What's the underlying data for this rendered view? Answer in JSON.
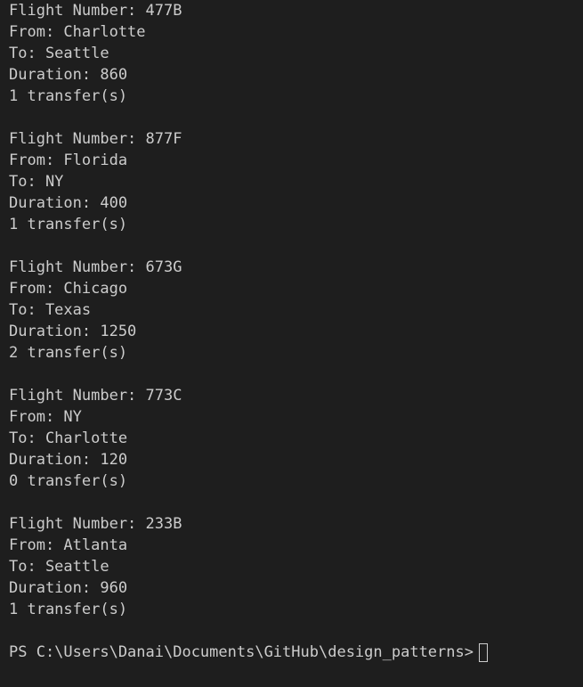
{
  "terminal": {
    "flights": [
      {
        "number_line": "Flight Number: 477B",
        "from_line": "From: Charlotte",
        "to_line": "To: Seattle",
        "duration_line": "Duration: 860",
        "transfers_line": "1 transfer(s)"
      },
      {
        "number_line": "Flight Number: 877F",
        "from_line": "From: Florida",
        "to_line": "To: NY",
        "duration_line": "Duration: 400",
        "transfers_line": "1 transfer(s)"
      },
      {
        "number_line": "Flight Number: 673G",
        "from_line": "From: Chicago",
        "to_line": "To: Texas",
        "duration_line": "Duration: 1250",
        "transfers_line": "2 transfer(s)"
      },
      {
        "number_line": "Flight Number: 773C",
        "from_line": "From: NY",
        "to_line": "To: Charlotte",
        "duration_line": "Duration: 120",
        "transfers_line": "0 transfer(s)"
      },
      {
        "number_line": "Flight Number: 233B",
        "from_line": "From: Atlanta",
        "to_line": "To: Seattle",
        "duration_line": "Duration: 960",
        "transfers_line": "1 transfer(s)"
      }
    ],
    "prompt": "PS C:\\Users\\Danai\\Documents\\GitHub\\design_patterns>"
  },
  "colors": {
    "background": "#1e1e1e",
    "text": "#cccccc"
  }
}
